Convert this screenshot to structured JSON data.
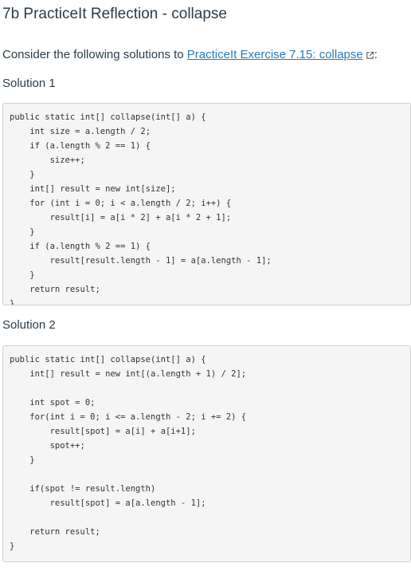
{
  "page": {
    "title": "7b PracticeIt Reflection - collapse",
    "intro_prefix": "Consider the following solutions to ",
    "intro_link": "PracticeIt Exercise 7.15: collapse",
    "intro_suffix": ":"
  },
  "solution1": {
    "heading": "Solution 1",
    "lines": [
      "public static int[] collapse(int[] a) {",
      "    int size = a.length / 2;",
      "    if (a.length % 2 == 1) {",
      "        size++;",
      "    }",
      "    int[] result = new int[size];",
      "    for (int i = 0; i < a.length / 2; i++) {",
      "        result[i] = a[i * 2] + a[i * 2 + 1];",
      "    }",
      "    if (a.length % 2 == 1) {",
      "        result[result.length - 1] = a[a.length - 1];",
      "    }",
      "    return result;",
      "}"
    ]
  },
  "solution2": {
    "heading": "Solution 2",
    "lines": [
      "public static int[] collapse(int[] a) {",
      "    int[] result = new int[(a.length + 1) / 2];",
      "",
      "    int spot = 0;",
      "    for(int i = 0; i <= a.length - 2; i += 2) {",
      "        result[spot] = a[i] + a[i+1];",
      "        spot++;",
      "    }",
      "",
      "    if(spot != result.length)",
      "        result[spot] = a[a.length - 1];",
      "",
      "    return result;",
      "}"
    ]
  }
}
